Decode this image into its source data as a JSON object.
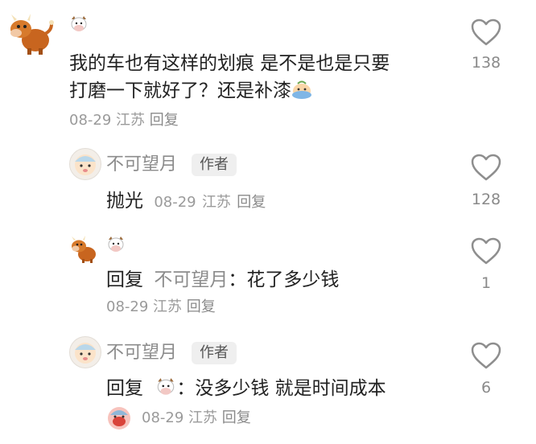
{
  "comments": [
    {
      "username_emoji": "cow-face",
      "text_line1": "我的车也有这样的划痕 是不是也是只要",
      "text_line2": "打磨一下就好了？还是补漆",
      "date": "08-29",
      "location": "江苏",
      "reply_label": "回复",
      "likes": "138",
      "inline_emoji": "crying-emoji"
    }
  ],
  "replies": [
    {
      "username": "不可望月",
      "author_tag": "作者",
      "text": "抛光",
      "date": "08-29",
      "location": "江苏",
      "reply_label": "回复",
      "likes": "128"
    },
    {
      "username_emoji": "cow-face",
      "reply_prefix": "回复",
      "reply_to": "不可望月",
      "colon": "：",
      "text": "花了多少钱",
      "date": "08-29",
      "location": "江苏",
      "reply_label": "回复",
      "likes": "1"
    },
    {
      "username": "不可望月",
      "author_tag": "作者",
      "reply_prefix": "回复",
      "reply_to_emoji": "cow-face",
      "colon": "：",
      "text": "没多少钱 就是时间成本",
      "date": "08-29",
      "location": "江苏",
      "reply_label": "回复",
      "likes": "6"
    }
  ],
  "colors": {
    "text_primary": "#222222",
    "text_secondary": "#8c8c8c",
    "tag_bg": "#efefef"
  },
  "icons": [
    "heart-outline-icon"
  ]
}
